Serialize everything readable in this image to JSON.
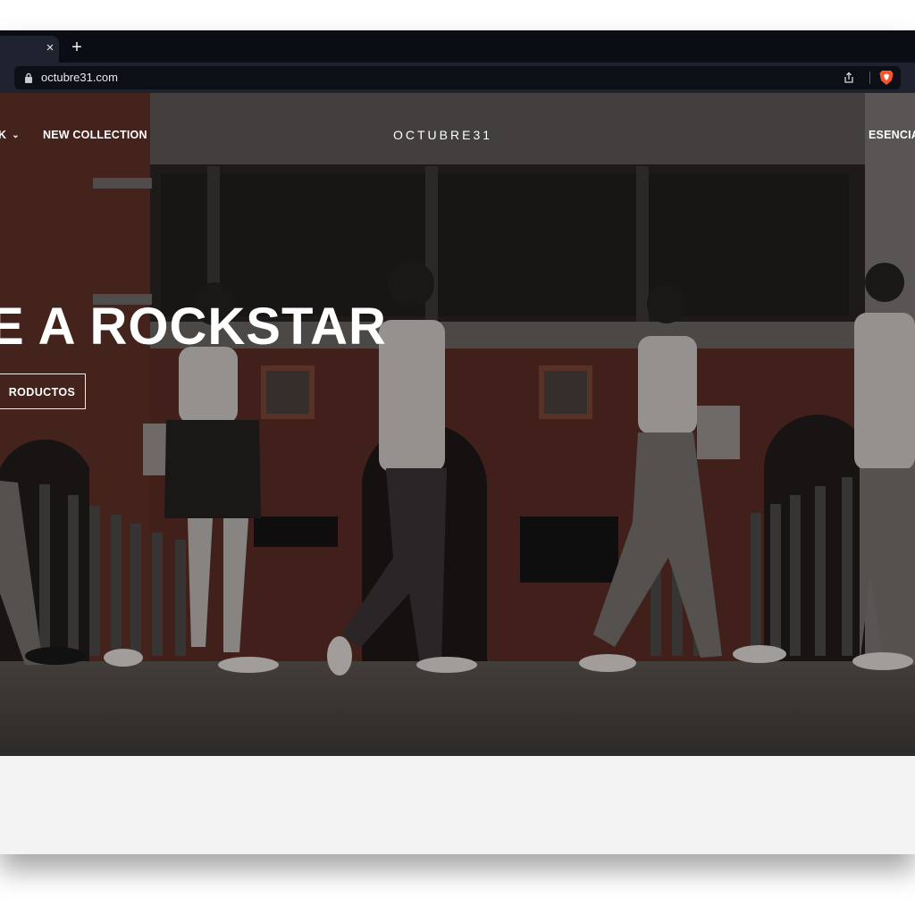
{
  "browser": {
    "url": "octubre31.com",
    "tab_close_glyph": "×",
    "new_tab_glyph": "+",
    "icons": [
      "close-icon",
      "plus-icon",
      "lock-icon",
      "share-icon",
      "brave-shield-icon"
    ]
  },
  "site": {
    "nav_left_partial": "K",
    "nav_new_collection": "NEW COLLECTION",
    "logo": "OCTUBRE31",
    "nav_right_partial": "ESENCIA",
    "hero_headline": "E A ROCKSTAR",
    "cta_label": "RODUCTOS"
  },
  "colors": {
    "tabbar": "#0b0d14",
    "toolbar": "#1f2330",
    "brave_orange": "#fb542b",
    "page_bg": "#f2f3f2"
  }
}
